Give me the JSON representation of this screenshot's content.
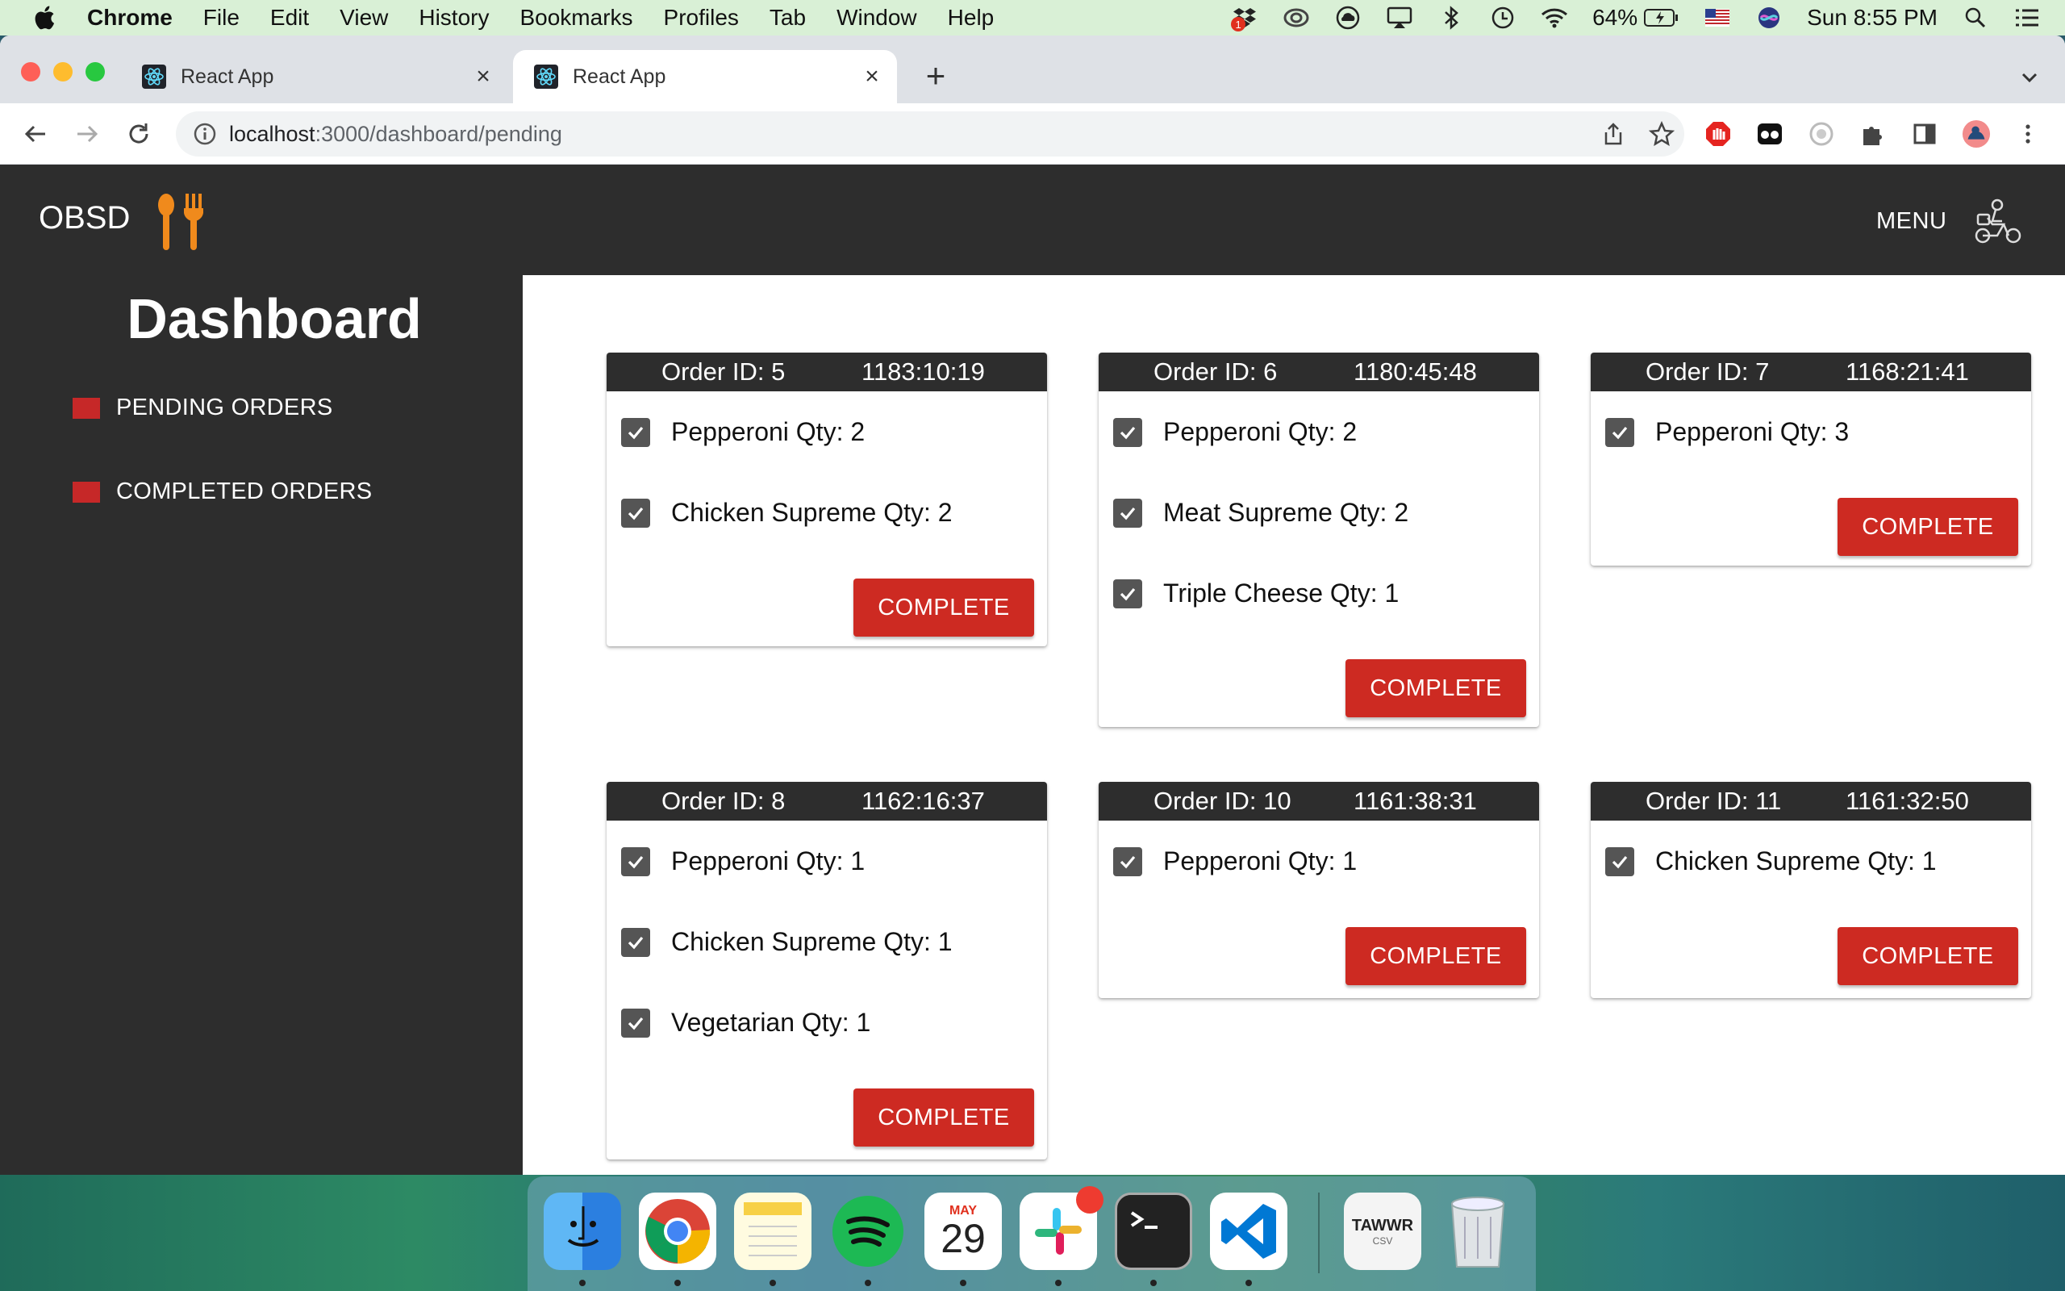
{
  "menubar": {
    "app": "Chrome",
    "items": [
      "File",
      "Edit",
      "View",
      "History",
      "Bookmarks",
      "Profiles",
      "Tab",
      "Window",
      "Help"
    ],
    "battery": "64%",
    "clock": "Sun 8:55 PM",
    "notification_badge": "1"
  },
  "browser": {
    "tabs": [
      {
        "label": "React App"
      },
      {
        "label": "React App"
      }
    ],
    "url_host": "localhost",
    "url_path": ":3000/dashboard/pending"
  },
  "app": {
    "brand": "OBSD",
    "menu_label": "MENU",
    "sidebar": {
      "title": "Dashboard",
      "items": [
        {
          "label": "PENDING ORDERS"
        },
        {
          "label": "COMPLETED ORDERS"
        }
      ]
    },
    "complete_label": "COMPLETE",
    "orders": [
      {
        "id": "Order ID: 5",
        "time": "1183:10:19",
        "items": [
          "Pepperoni Qty: 2",
          "Chicken Supreme Qty: 2"
        ]
      },
      {
        "id": "Order ID: 6",
        "time": "1180:45:48",
        "items": [
          "Pepperoni Qty: 2",
          "Meat Supreme Qty: 2",
          "Triple Cheese Qty: 1"
        ]
      },
      {
        "id": "Order ID: 7",
        "time": "1168:21:41",
        "items": [
          "Pepperoni Qty: 3"
        ]
      },
      {
        "id": "Order ID: 8",
        "time": "1162:16:37",
        "items": [
          "Pepperoni Qty: 1",
          "Chicken Supreme Qty: 1",
          "Vegetarian Qty: 1"
        ]
      },
      {
        "id": "Order ID: 10",
        "time": "1161:38:31",
        "items": [
          "Pepperoni Qty: 1"
        ]
      },
      {
        "id": "Order ID: 11",
        "time": "1161:32:50",
        "items": [
          "Chicken Supreme Qty: 1"
        ]
      }
    ]
  },
  "dock": {
    "calendar_month": "MAY",
    "calendar_day": "29",
    "file_label": "TAWWR",
    "file_ext": "CSV"
  },
  "colors": {
    "accent_red": "#cd2a22",
    "app_dark": "#2d2d2d",
    "brand_orange": "#f08a1c"
  }
}
